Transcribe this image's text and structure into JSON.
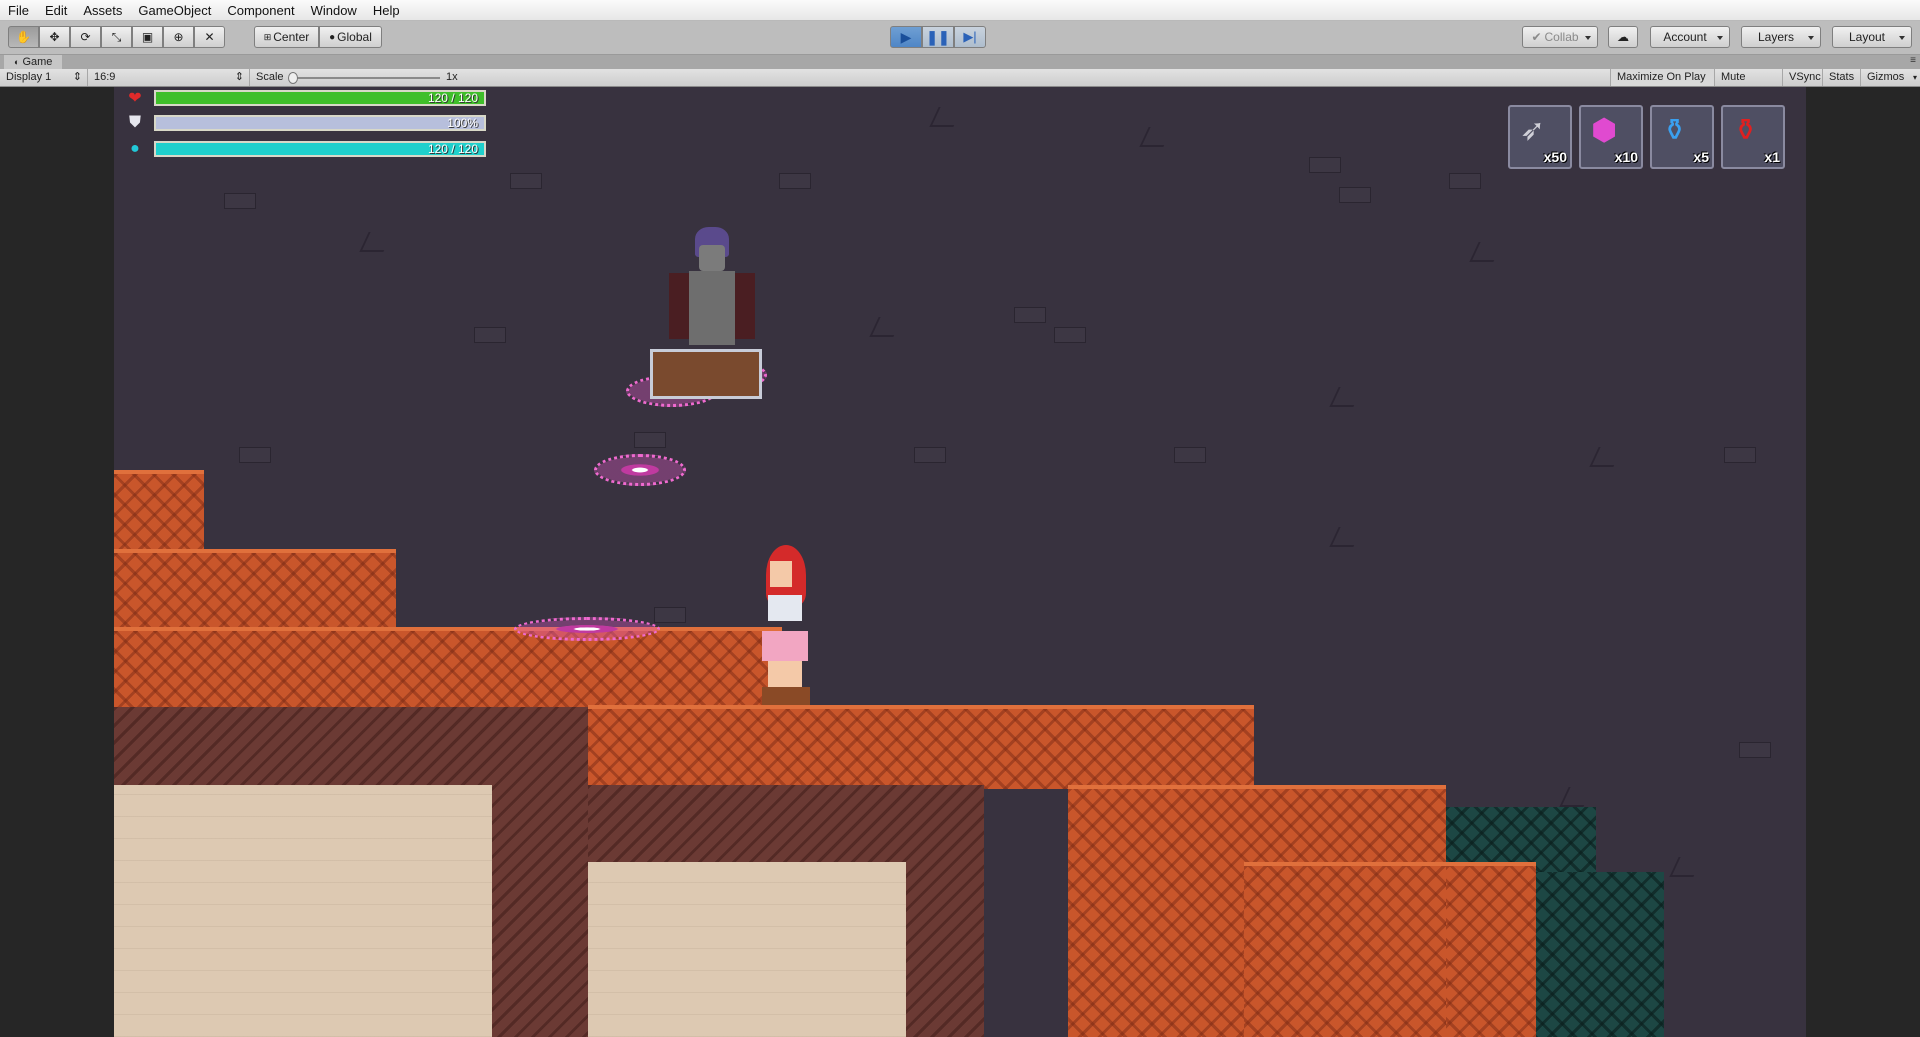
{
  "menu": [
    "File",
    "Edit",
    "Assets",
    "GameObject",
    "Component",
    "Window",
    "Help"
  ],
  "toolbar": {
    "tools": [
      "hand-icon",
      "move-icon",
      "rotate-icon",
      "scale-icon",
      "rect-icon",
      "transform-icon",
      "custom-tool-icon"
    ],
    "pivot": "Center",
    "space": "Global",
    "collab": "Collab",
    "account": "Account",
    "layers": "Layers",
    "layout": "Layout"
  },
  "tab": {
    "title": "Game"
  },
  "gamebar": {
    "display": "Display 1",
    "aspect": "16:9",
    "scale_label": "Scale",
    "scale_value": "1x",
    "maximize": "Maximize On Play",
    "mute": "Mute Audio",
    "vsync": "VSync",
    "stats": "Stats",
    "gizmos": "Gizmos"
  },
  "hud": {
    "health": {
      "text": "120 / 120",
      "fraction": 1.0,
      "color": "#3fbf2a",
      "icon": "heart-icon"
    },
    "armor": {
      "text": "100%",
      "fraction": 1.0,
      "color": "#b7bfdc",
      "icon": "shield-icon"
    },
    "mana": {
      "text": "120 / 120",
      "fraction": 1.0,
      "color": "#1fd0cc",
      "icon": "mana-orb-icon"
    }
  },
  "inventory": [
    {
      "name": "arrows",
      "icon": "arrow-bundle-icon",
      "count": "x50"
    },
    {
      "name": "gem",
      "icon": "pink-gem-icon",
      "count": "x10"
    },
    {
      "name": "mana-potion",
      "icon": "blue-potion-icon",
      "count": "x5"
    },
    {
      "name": "health-potion",
      "icon": "red-potion-icon",
      "count": "x1"
    }
  ]
}
